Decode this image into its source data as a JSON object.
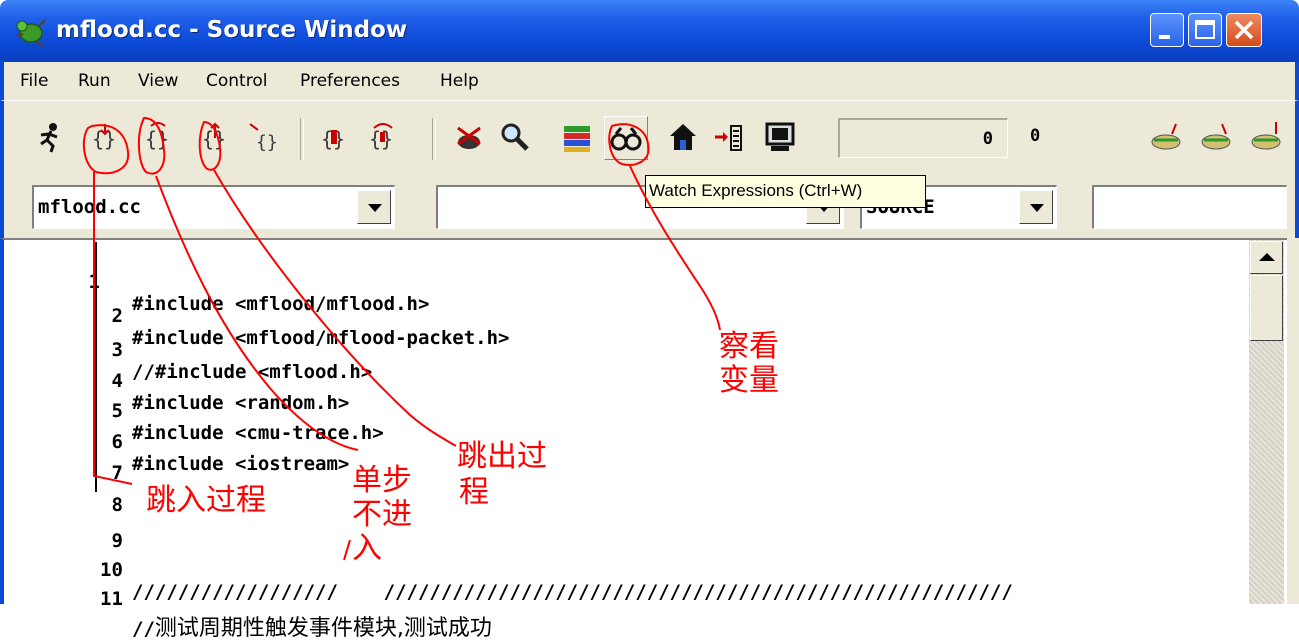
{
  "window": {
    "title": "mflood.cc - Source Window"
  },
  "menu": {
    "items": [
      {
        "label": "File"
      },
      {
        "label": "Run"
      },
      {
        "label": "View"
      },
      {
        "label": "Control"
      },
      {
        "label": "Preferences"
      },
      {
        "label": "Help"
      }
    ]
  },
  "toolbar": {
    "icons": [
      "run-icon",
      "step-icon",
      "next-icon",
      "finish-icon",
      "continue-icon",
      "step-asm-icon",
      "next-asm-icon",
      "stop-icon",
      "search-icon",
      "stack-icon",
      "watch-expressions-icon",
      "home-icon",
      "locals-icon",
      "console-icon",
      "up-frame-icon",
      "down-frame-icon",
      "bottom-frame-icon"
    ],
    "counter_1": "0",
    "counter_2": "0"
  },
  "tooltip": {
    "text": "Watch Expressions (Ctrl+W)"
  },
  "combos": {
    "file": "mflood.cc",
    "function": "",
    "mode": "SOURCE",
    "extra": ""
  },
  "source_lines": [
    {
      "num": "1",
      "text": "#include <mflood/mflood.h>"
    },
    {
      "num": "2",
      "text": "#include <mflood/mflood-packet.h>"
    },
    {
      "num": "3",
      "text": "//#include <mflood.h>"
    },
    {
      "num": "4",
      "text": "#include <random.h>"
    },
    {
      "num": "5",
      "text": "#include <cmu-trace.h>"
    },
    {
      "num": "6",
      "text": "#include <iostream>"
    },
    {
      "num": "7",
      "text": ""
    },
    {
      "num": "8",
      "text": ""
    },
    {
      "num": "9",
      "text": ""
    },
    {
      "num": "10",
      "text": "//////////////////    ///////////////////////////////////////////////////////"
    },
    {
      "num": "11",
      "text_prefix": "//",
      "text_cjk": "测试周期性触发事件模块,测试成功"
    }
  ],
  "annotations": {
    "step_into": "跳入过程",
    "step_over_line1": "单步",
    "step_over_line2": "不进",
    "step_over_line3": "入",
    "step_out_line1": "跳出过",
    "step_out_line2": "程",
    "watch_line1": "察看",
    "watch_line2": "变量"
  },
  "colors": {
    "title_bar": "#0a49d6",
    "chrome": "#ece9d8",
    "annotation": "#ff0000",
    "tooltip_bg": "#ffffe1"
  }
}
